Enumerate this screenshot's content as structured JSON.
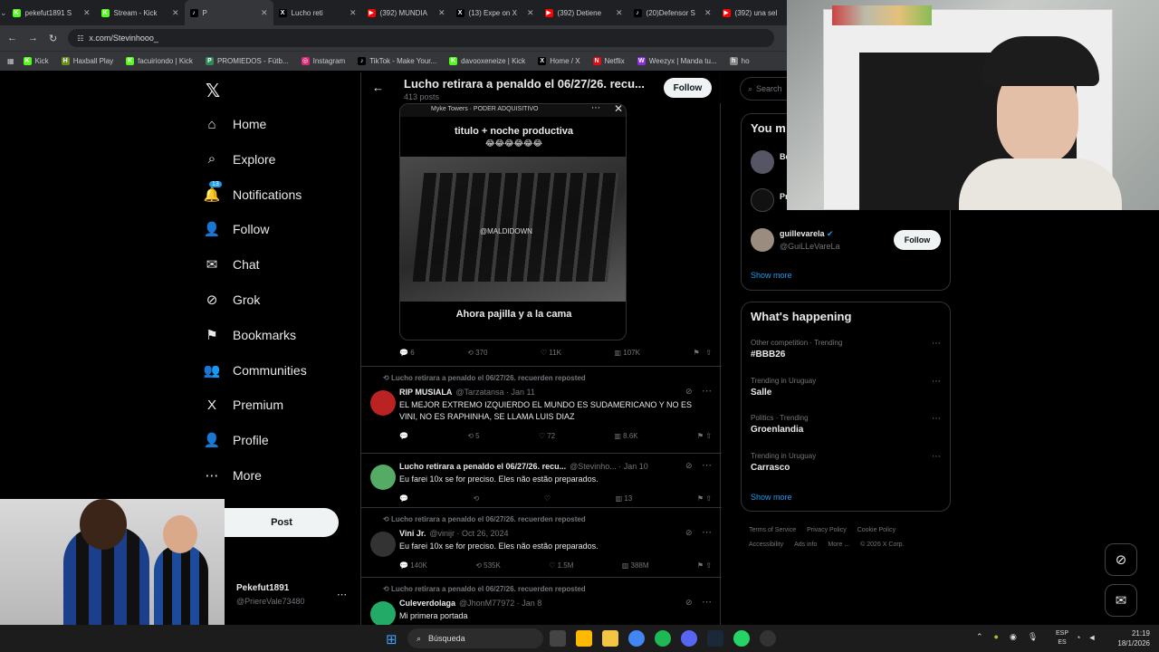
{
  "browser": {
    "tabs": [
      {
        "label": "pekefut1891 S",
        "color": "#53fc18",
        "glyph": "K"
      },
      {
        "label": "Stream - Kick",
        "color": "#53fc18",
        "glyph": "K"
      },
      {
        "label": "P",
        "color": "#000000",
        "glyph": "♪",
        "active": true
      },
      {
        "label": "Lucho reti",
        "color": "#000000",
        "glyph": "X"
      },
      {
        "label": "(392) MUNDIA",
        "color": "#ff0000",
        "glyph": "▶"
      },
      {
        "label": "(13) Expe on X",
        "color": "#000000",
        "glyph": "X"
      },
      {
        "label": "(392) Detiene",
        "color": "#ff0000",
        "glyph": "▶"
      },
      {
        "label": "(20)Defensor S",
        "color": "#000000",
        "glyph": "♪"
      },
      {
        "label": "(392) una sel",
        "color": "#ff0000",
        "glyph": "▶"
      }
    ],
    "url": "x.com/Stevinhooo_",
    "bookmarks": [
      {
        "label": "Kick",
        "color": "#53fc18",
        "glyph": "K"
      },
      {
        "label": "Haxball Play",
        "color": "#6b8e23",
        "glyph": "H"
      },
      {
        "label": "facuiriondo | Kick",
        "color": "#53fc18",
        "glyph": "K"
      },
      {
        "label": "PROMIEDOS - Fútb...",
        "color": "#2e8b57",
        "glyph": "P"
      },
      {
        "label": "Instagram",
        "color": "#d62976",
        "glyph": "◎"
      },
      {
        "label": "TikTok - Make Your...",
        "color": "#000000",
        "glyph": "♪"
      },
      {
        "label": "davooxeneize | Kick",
        "color": "#53fc18",
        "glyph": "K"
      },
      {
        "label": "Home / X",
        "color": "#000000",
        "glyph": "X"
      },
      {
        "label": "Netflix",
        "color": "#e50914",
        "glyph": "N"
      },
      {
        "label": "Weezyx | Manda tu...",
        "color": "#8a2be2",
        "glyph": "W"
      },
      {
        "label": "ho",
        "color": "#888888",
        "glyph": "h"
      }
    ]
  },
  "sidebar": {
    "items": [
      {
        "label": "Home",
        "icon": "⌂"
      },
      {
        "label": "Explore",
        "icon": "⌕"
      },
      {
        "label": "Notifications",
        "icon": "🔔",
        "badge": "13"
      },
      {
        "label": "Follow",
        "icon": "👤"
      },
      {
        "label": "Chat",
        "icon": "✉"
      },
      {
        "label": "Grok",
        "icon": "⊘"
      },
      {
        "label": "Bookmarks",
        "icon": "⚑"
      },
      {
        "label": "Communities",
        "icon": "👥"
      },
      {
        "label": "Premium",
        "icon": "X"
      },
      {
        "label": "Profile",
        "icon": "👤"
      },
      {
        "label": "More",
        "icon": "⋯"
      }
    ],
    "post_label": "Post",
    "account_name": "Pekefut1891",
    "account_handle": "@PriereVale73480"
  },
  "header": {
    "title": "Lucho retirara a penaldo el 06/27/26. recu...",
    "subtitle": "413 posts",
    "follow_label": "Follow"
  },
  "media": {
    "topbar": "Myke Towers · PODER ADQUISITIVO",
    "caption_top": "titulo + noche productiva",
    "emojis": "😂😂😂😂😂😂",
    "watermark": "@MALDIDOWN",
    "caption_bottom": "Ahora pajilla y a la cama"
  },
  "first_actions": {
    "replies": "6",
    "reposts": "370",
    "likes": "11K",
    "views": "107K"
  },
  "tweets": [
    {
      "repost_line": "Lucho retirara a penaldo el 06/27/26. recuerden reposted",
      "name": "RIP MUSIALA",
      "handle": "@Tarzatansa · Jan 11",
      "text": "EL MEJOR EXTREMO IZQUIERDO EL MUNDO ES SUDAMERICANO Y NO ES VINI, NO ES RAPHINHA, SE LLAMA LUIS DIAZ",
      "replies": "",
      "reposts": "5",
      "likes": "72",
      "views": "8.6K"
    },
    {
      "repost_line": "",
      "name": "Lucho retirara a penaldo el 06/27/26. recu...",
      "handle": "@Stevinho... · Jan 10",
      "text": "Eu farei 10x se for preciso. Eles não estão preparados.",
      "replies": "",
      "reposts": "",
      "likes": "",
      "views": "13"
    },
    {
      "repost_line": "Lucho retirara a penaldo el 06/27/26. recuerden reposted",
      "name": "Vini Jr.",
      "handle": "@vinijr · Oct 26, 2024",
      "text": "Eu farei 10x se for preciso. Eles não estão preparados.",
      "replies": "140K",
      "reposts": "535K",
      "likes": "1.5M",
      "views": "388M"
    },
    {
      "repost_line": "Lucho retirara a penaldo el 06/27/26. recuerden reposted",
      "name": "Culeverdolaga",
      "handle": "@JhonM77972 · Jan 8",
      "text": "Mi primera portada",
      "replies": "",
      "reposts": "",
      "likes": "",
      "views": ""
    }
  ],
  "right": {
    "search_placeholder": "Search",
    "you_might_like": "You m",
    "suggest_partial": [
      "Be",
      "Pr"
    ],
    "suggest_name": "guillevarela",
    "suggest_handle": "@GuiLLeVareLa",
    "suggest_follow": "Follow",
    "show_more": "Show more",
    "happening_title": "What's happening",
    "trends": [
      {
        "context": "Other competition · Trending",
        "name": "#BBB26"
      },
      {
        "context": "Trending in Uruguay",
        "name": "Salle"
      },
      {
        "context": "Politics · Trending",
        "name": "Groenlandia"
      },
      {
        "context": "Trending in Uruguay",
        "name": "Carrasco"
      }
    ],
    "show_more_2": "Show more",
    "footer": [
      "Terms of Service",
      "Privacy Policy",
      "Cookie Policy",
      "Accessibility",
      "Ads info",
      "More ...",
      "© 2026 X Corp."
    ]
  },
  "taskbar": {
    "search_label": "Búsqueda",
    "lang": "ESP",
    "lang2": "ES",
    "time": "21:19",
    "date": "18/1/2026"
  }
}
